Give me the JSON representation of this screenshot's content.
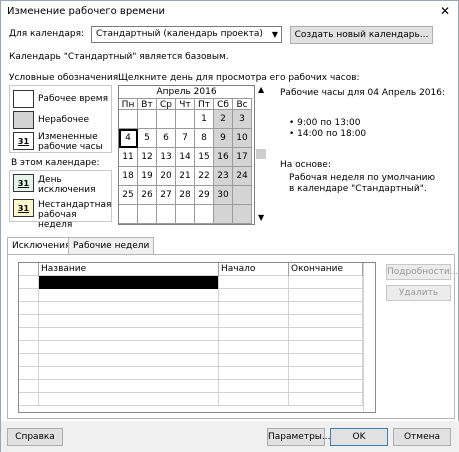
{
  "window": {
    "title": "Изменение рабочего времени",
    "close_glyph": "✕"
  },
  "calendar_select": {
    "label": "Для календаря:",
    "value": "Стандартный (календарь проекта)",
    "create_button": "Создать новый календарь..."
  },
  "base_info": "Календарь \"Стандартный\" является базовым.",
  "legend": {
    "title": "Условные обозначения:",
    "items": [
      {
        "label": "Рабочее время",
        "glyph": ""
      },
      {
        "label": "Нерабочее",
        "glyph": ""
      },
      {
        "label": "Измененные рабочие часы",
        "glyph": "31"
      }
    ],
    "in_calendar_title": "В этом календаре:",
    "calendar_items": [
      {
        "label": "День исключения",
        "glyph": "31"
      },
      {
        "label": "Нестандартная рабочая неделя",
        "glyph": "31"
      }
    ]
  },
  "calendar": {
    "instruction": "Щелкните день для просмотра его рабочих часов:",
    "month_title": "Апрель 2016",
    "weekdays": [
      "Пн",
      "Вт",
      "Ср",
      "Чт",
      "Пт",
      "Сб",
      "Вс"
    ],
    "weeks": [
      [
        "",
        "",
        "",
        "",
        "1",
        "2",
        "3"
      ],
      [
        "4",
        "5",
        "6",
        "7",
        "8",
        "9",
        "10"
      ],
      [
        "11",
        "12",
        "13",
        "14",
        "15",
        "16",
        "17"
      ],
      [
        "18",
        "19",
        "20",
        "21",
        "22",
        "23",
        "24"
      ],
      [
        "25",
        "26",
        "27",
        "28",
        "29",
        "30",
        ""
      ],
      [
        "",
        "",
        "",
        "",
        "",
        "",
        ""
      ]
    ],
    "selected_day": "4",
    "scroll_up": "▲",
    "scroll_down": "▼"
  },
  "working_hours": {
    "heading": "Рабочие часы для 04 Апрель 2016:",
    "intervals": [
      "9:00 по 13:00",
      "14:00 по 18:00"
    ],
    "based_on_label": "На основе:",
    "based_on_text": "Рабочая неделя по умолчанию в календаре \"Стандартный\"."
  },
  "tabs": [
    {
      "label": "Исключения",
      "active": true
    },
    {
      "label": "Рабочие недели",
      "active": false
    }
  ],
  "table": {
    "columns": [
      "",
      "Название",
      "Начало",
      "Окончание"
    ],
    "row_count": 10,
    "side_buttons": [
      "Подробности...",
      "Удалить"
    ]
  },
  "footer": {
    "help": "Справка",
    "options": "Параметры...",
    "ok": "OK",
    "cancel": "Отмена"
  },
  "colors": {
    "nonworking": "#d4d4d4",
    "exception_box": "#e6f4ea",
    "nonstandard_box": "#fff8cc",
    "accent_border": "#3c7fb1"
  }
}
